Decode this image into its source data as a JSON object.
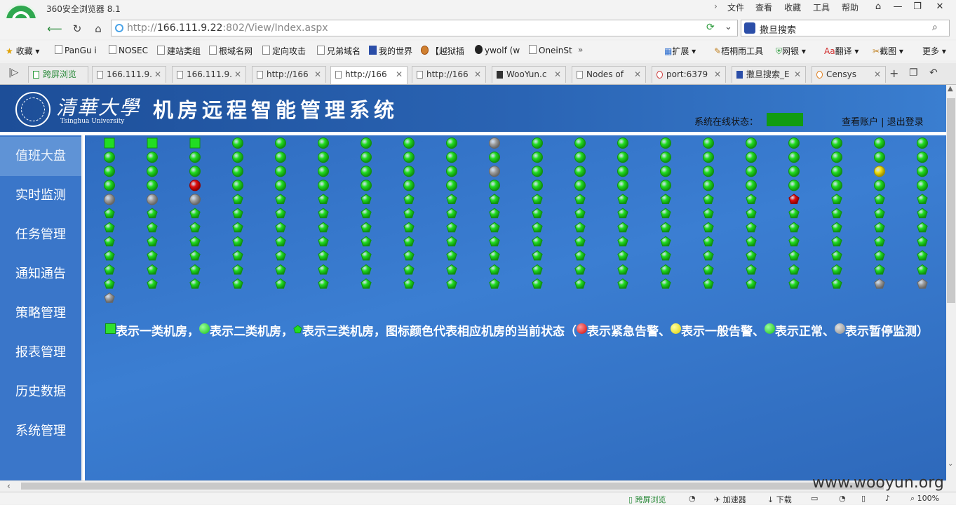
{
  "browser": {
    "title": "360安全浏览器 8.1",
    "menu": [
      "文件",
      "查看",
      "收藏",
      "工具",
      "帮助"
    ],
    "url": {
      "prefix": "http://",
      "host": "166.111.9.22",
      "rest": ":802/View/Index.aspx"
    },
    "search_text": "撒旦搜索",
    "bookmarks_left": [
      "收藏",
      "PanGu i",
      "NOSEC",
      "建站类组",
      "根域名网",
      "定向攻击",
      "兄弟域名",
      "我的世界",
      "【越狱插",
      "ywolf (w",
      "OneinSt"
    ],
    "bookmarks_right": [
      "扩展",
      "梧桐雨工具",
      "网银",
      "翻译",
      "截图",
      "更多"
    ],
    "tabs": [
      {
        "label": "跨屏浏览"
      },
      {
        "label": "166.111.9."
      },
      {
        "label": "166.111.9."
      },
      {
        "label": "http://166"
      },
      {
        "label": "http://166"
      },
      {
        "label": "http://166"
      },
      {
        "label": "WooYun.c"
      },
      {
        "label": "Nodes of"
      },
      {
        "label": "port:6379"
      },
      {
        "label": "撒旦搜索_E"
      },
      {
        "label": "Censys"
      }
    ],
    "status_bar": [
      "跨屏浏览",
      "加速器",
      "下载",
      "100%"
    ]
  },
  "header": {
    "logo_cn": "清華大學",
    "logo_en": "Tsinghua University",
    "system_title": "机房远程智能管理系统",
    "status_label": "系统在线状态：",
    "status_color": "#119c11",
    "account_links": "查看账户 | 退出登录"
  },
  "sidebar": {
    "items": [
      {
        "label": "值班大盘",
        "active": true
      },
      {
        "label": "实时监测"
      },
      {
        "label": "任务管理"
      },
      {
        "label": "通知通告"
      },
      {
        "label": "策略管理"
      },
      {
        "label": "报表管理"
      },
      {
        "label": "历史数据"
      },
      {
        "label": "系统管理"
      }
    ]
  },
  "colors": {
    "normal": "#22dd22",
    "urgent": "#e01010",
    "general": "#f0e010",
    "paused": "#a0a0a0"
  },
  "rooms": {
    "columns": [
      [
        "sq-n",
        "c-n",
        "c-n",
        "c-n",
        "c-p",
        "p-n",
        "p-n",
        "p-n",
        "p-n",
        "p-n",
        "p-n",
        "p-p"
      ],
      [
        "sq-n",
        "c-n",
        "c-n",
        "c-n",
        "c-p",
        "p-n",
        "p-n",
        "p-n",
        "p-n",
        "p-n",
        "p-n"
      ],
      [
        "sq-n",
        "c-n",
        "c-n",
        "c-u",
        "c-p",
        "p-n",
        "p-n",
        "p-n",
        "p-n",
        "p-n",
        "p-n"
      ],
      [
        "c-n",
        "c-n",
        "c-n",
        "c-n",
        "p-n",
        "p-n",
        "p-n",
        "p-n",
        "p-n",
        "p-n",
        "p-n"
      ],
      [
        "c-n",
        "c-n",
        "c-n",
        "c-n",
        "p-n",
        "p-n",
        "p-n",
        "p-n",
        "p-n",
        "p-n",
        "p-n"
      ],
      [
        "c-n",
        "c-n",
        "c-n",
        "c-n",
        "p-n",
        "p-n",
        "p-n",
        "p-n",
        "p-n",
        "p-n",
        "p-n"
      ],
      [
        "c-n",
        "c-n",
        "c-n",
        "c-n",
        "p-n",
        "p-n",
        "p-n",
        "p-n",
        "p-n",
        "p-n",
        "p-n"
      ],
      [
        "c-n",
        "c-n",
        "c-n",
        "c-n",
        "p-n",
        "p-n",
        "p-n",
        "p-n",
        "p-n",
        "p-n",
        "p-n"
      ],
      [
        "c-n",
        "c-n",
        "c-n",
        "c-n",
        "p-n",
        "p-n",
        "p-n",
        "p-n",
        "p-n",
        "p-n",
        "p-n"
      ],
      [
        "c-p",
        "c-n",
        "c-p",
        "c-n",
        "p-n",
        "p-n",
        "p-n",
        "p-n",
        "p-n",
        "p-n",
        "p-n"
      ],
      [
        "c-n",
        "c-n",
        "c-n",
        "c-n",
        "p-n",
        "p-n",
        "p-n",
        "p-n",
        "p-n",
        "p-n",
        "p-n"
      ],
      [
        "c-n",
        "c-n",
        "c-n",
        "c-n",
        "p-n",
        "p-n",
        "p-n",
        "p-n",
        "p-n",
        "p-n",
        "p-n"
      ],
      [
        "c-n",
        "c-n",
        "c-n",
        "c-n",
        "p-n",
        "p-n",
        "p-n",
        "p-n",
        "p-n",
        "p-n",
        "p-n"
      ],
      [
        "c-n",
        "c-n",
        "c-n",
        "c-n",
        "p-n",
        "p-n",
        "p-n",
        "p-n",
        "p-n",
        "p-n",
        "p-n"
      ],
      [
        "c-n",
        "c-n",
        "c-n",
        "c-n",
        "p-n",
        "p-n",
        "p-n",
        "p-n",
        "p-n",
        "p-n",
        "p-n"
      ],
      [
        "c-n",
        "c-n",
        "c-n",
        "c-n",
        "p-n",
        "p-n",
        "p-n",
        "p-n",
        "p-n",
        "p-n",
        "p-n"
      ],
      [
        "c-n",
        "c-n",
        "c-n",
        "c-n",
        "p-u",
        "p-n",
        "p-n",
        "p-n",
        "p-n",
        "p-n",
        "p-n"
      ],
      [
        "c-n",
        "c-n",
        "c-n",
        "c-n",
        "p-n",
        "p-n",
        "p-n",
        "p-n",
        "p-n",
        "p-n",
        "p-n"
      ],
      [
        "c-n",
        "c-n",
        "c-g",
        "c-n",
        "p-n",
        "p-n",
        "p-n",
        "p-n",
        "p-n",
        "p-n",
        "p-p"
      ],
      [
        "c-n",
        "c-n",
        "c-n",
        "c-n",
        "p-n",
        "p-n",
        "p-n",
        "p-n",
        "p-n",
        "p-n",
        "p-p"
      ]
    ]
  },
  "legend": {
    "t1": "表示一类机房，",
    "t2": "表示二类机房，",
    "t3": "表示三类机房，图标颜色代表相应机房的当前状态（",
    "t4": "表示紧急告警、",
    "t5": "表示一般告警、",
    "t6": "表示正常、",
    "t7": "表示暂停监测）"
  },
  "watermark": "www.wooyun.org"
}
